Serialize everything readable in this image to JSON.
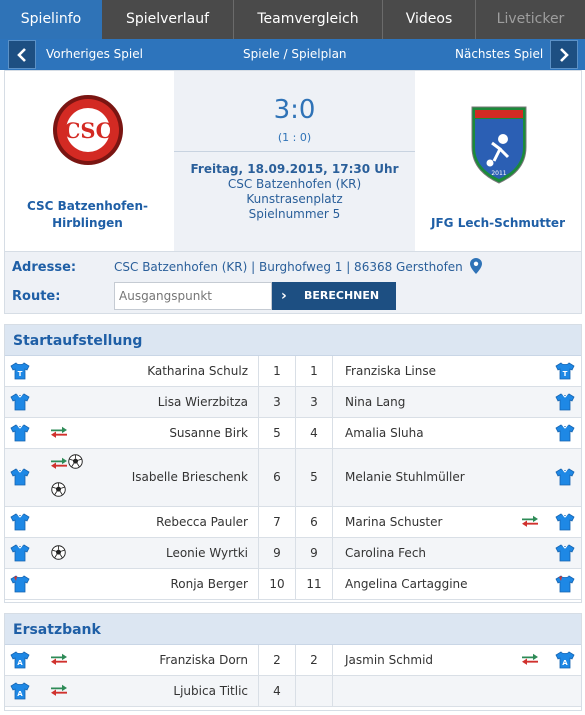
{
  "tabs": [
    {
      "label": "Spielinfo",
      "state": "active"
    },
    {
      "label": "Spielverlauf",
      "state": "normal"
    },
    {
      "label": "Teamvergleich",
      "state": "normal"
    },
    {
      "label": "Videos",
      "state": "normal"
    },
    {
      "label": "Liveticker",
      "state": "disabled"
    }
  ],
  "nav": {
    "prev_label": "Vorheriges Spiel",
    "center_label": "Spiele / Spielplan",
    "next_label": "Nächstes Spiel"
  },
  "match": {
    "home_team": "CSC Batzenhofen-Hirblingen",
    "away_team": "JFG Lech-Schmutter",
    "score": "3:0",
    "halftime": "(1 : 0)",
    "date": "Freitag, 18.09.2015, 17:30 Uhr",
    "venue": "CSC Batzenhofen (KR)",
    "pitch": "Kunstrasenplatz",
    "game_number": "Spielnummer 5",
    "home_logo_text": "CSC",
    "away_logo_text": "2011"
  },
  "address": {
    "address_label": "Adresse:",
    "address_text": "CSC Batzenhofen (KR)  |  Burghofweg 1  |  86368 Gersthofen",
    "route_label": "Route:",
    "route_placeholder": "Ausgangspunkt",
    "route_button": "BERECHNEN"
  },
  "lineup": {
    "title": "Startaufstellung",
    "rows": [
      {
        "home": "Katharina Schulz",
        "home_no": "1",
        "away_no": "1",
        "away": "Franziska Linse"
      },
      {
        "home": "Lisa Wierzbitza",
        "home_no": "3",
        "away_no": "3",
        "away": "Nina Lang"
      },
      {
        "home": "Susanne Birk",
        "home_no": "5",
        "away_no": "4",
        "away": "Amalia Sluha"
      },
      {
        "home": "Isabelle Brieschenk",
        "home_no": "6",
        "away_no": "5",
        "away": "Melanie Stuhlmüller"
      },
      {
        "home": "Rebecca Pauler",
        "home_no": "7",
        "away_no": "6",
        "away": "Marina Schuster"
      },
      {
        "home": "Leonie Wyrtki",
        "home_no": "9",
        "away_no": "9",
        "away": "Carolina Fech"
      },
      {
        "home": "Ronja Berger",
        "home_no": "10",
        "away_no": "11",
        "away": "Angelina Cartaggine"
      }
    ]
  },
  "bench": {
    "title": "Ersatzbank",
    "rows": [
      {
        "home": "Franziska Dorn",
        "home_no": "2",
        "away_no": "2",
        "away": "Jasmin Schmid"
      },
      {
        "home": "Ljubica Titlic",
        "home_no": "4",
        "away_no": "",
        "away": ""
      }
    ]
  },
  "colors": {
    "primary": "#2f73b7",
    "dark_blue": "#1d4f82",
    "tab_bar": "#4a4a4a",
    "shirt_blue": "#1e88e5",
    "sub_green": "#2e8b57",
    "sub_red": "#d0312d"
  }
}
